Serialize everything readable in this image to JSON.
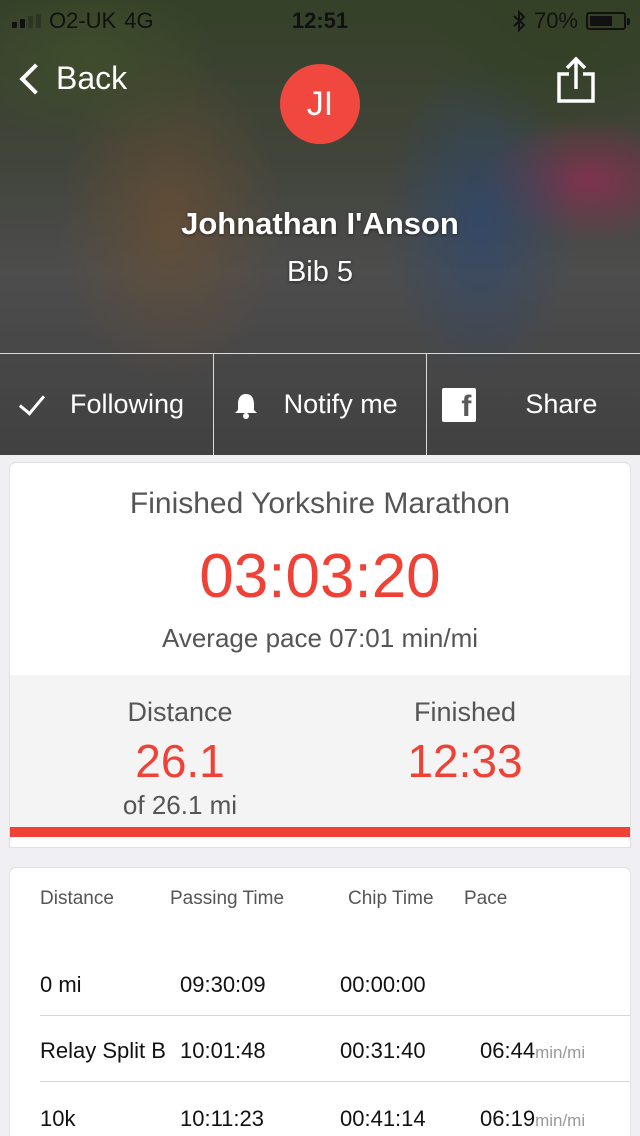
{
  "status_bar": {
    "carrier": "O2-UK",
    "network": "4G",
    "time": "12:51",
    "battery": "70%",
    "battery_level": 0.7
  },
  "nav": {
    "back_label": "Back"
  },
  "runner": {
    "initials": "JI",
    "name": "Johnathan I'Anson",
    "bib": "Bib 5"
  },
  "actions": {
    "following_label": "Following",
    "notify_label": "Notify me",
    "share_label": "Share"
  },
  "result": {
    "title": "Finished Yorkshire Marathon",
    "time": "03:03:20",
    "avg_pace": "Average pace 07:01 min/mi",
    "distance_label": "Distance",
    "distance_value": "26.1",
    "distance_total": "of 26.1 mi",
    "finished_label": "Finished",
    "finished_value": "12:33",
    "progress": 1.0
  },
  "splits": {
    "headers": [
      "Distance",
      "Passing Time",
      "Chip Time",
      "Pace"
    ],
    "rows": [
      {
        "distance": "0 mi",
        "passing": "09:30:09",
        "chip": "00:00:00",
        "pace": "",
        "unit": ""
      },
      {
        "distance": "Relay Split B",
        "passing": "10:01:48",
        "chip": "00:31:40",
        "pace": "06:44",
        "unit": "min/mi"
      },
      {
        "distance": "10k",
        "passing": "10:11:23",
        "chip": "00:41:14",
        "pace": "06:19",
        "unit": "min/mi"
      }
    ]
  },
  "colors": {
    "accent": "#ef4136",
    "avatar": "#f0483e"
  }
}
